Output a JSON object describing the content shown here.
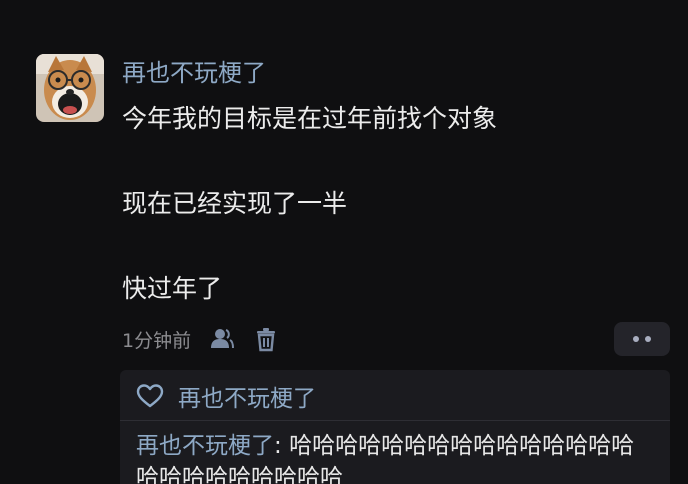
{
  "post": {
    "avatar_icon": "shiba-dog-with-glasses-avatar",
    "author": "再也不玩梗了",
    "content_lines": [
      "今年我的目标是在过年前找个对象",
      "现在已经实现了一半",
      "快过年了"
    ],
    "time": "1分钟前",
    "icons": {
      "user": "person-icon",
      "delete": "trash-icon",
      "more": "more-dots-icon"
    }
  },
  "likes": {
    "icon": "heart-outline-icon",
    "names": "再也不玩梗了"
  },
  "replies": [
    {
      "author": "再也不玩梗了",
      "separator": ": ",
      "text": "哈哈哈哈哈哈哈哈哈哈哈哈哈哈哈哈哈哈哈哈哈哈哈哈"
    }
  ],
  "colors": {
    "background": "#0f0f11",
    "name_blue": "#8ea9c6",
    "text": "#ececec",
    "muted": "#8c8c90",
    "panel": "#1b1b1f"
  }
}
